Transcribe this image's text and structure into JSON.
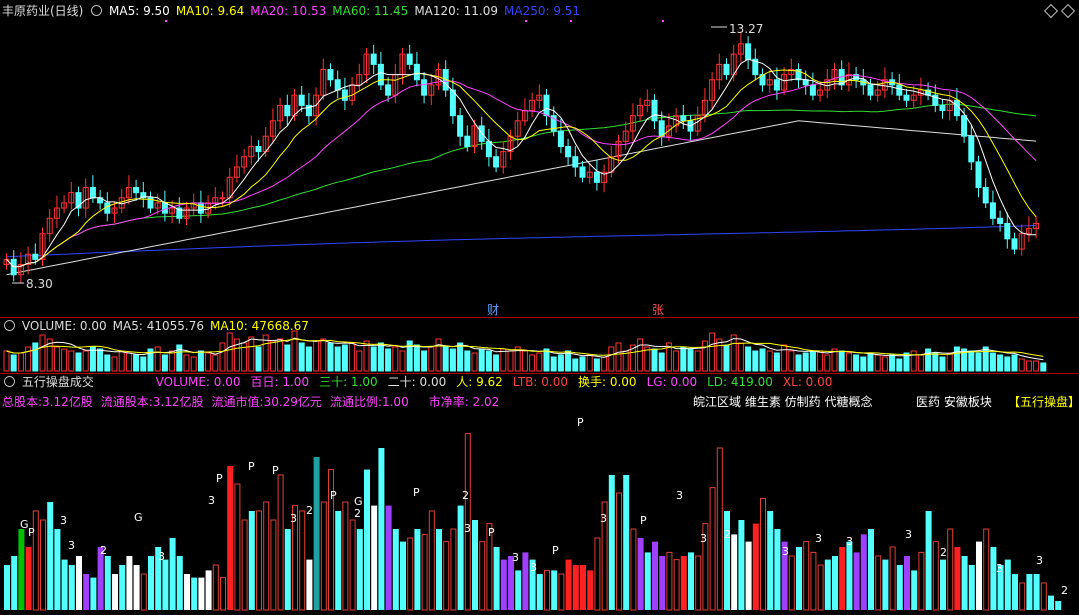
{
  "header": {
    "title": "丰原药业(日线)",
    "ma_items": [
      {
        "label": "MA5: 9.50",
        "color": "#ffffff"
      },
      {
        "label": "MA10: 9.64",
        "color": "#ffff00"
      },
      {
        "label": "MA20: 10.53",
        "color": "#ff44ff"
      },
      {
        "label": "MA60: 11.45",
        "color": "#33dd33"
      },
      {
        "label": "MA120: 11.09",
        "color": "#dddddd"
      },
      {
        "label": "MA250: 9.51",
        "color": "#3344ff"
      }
    ]
  },
  "price_panel": {
    "high_label": "13.27",
    "low_label": "8.30",
    "event_markers": [
      "财",
      "张"
    ]
  },
  "volume_header": {
    "items": [
      {
        "label": "VOLUME: 0.00",
        "color": "#dddddd"
      },
      {
        "label": "MA5: 41055.76",
        "color": "#dddddd"
      },
      {
        "label": "MA10: 47668.67",
        "color": "#ffff00"
      }
    ]
  },
  "indicator_header": {
    "name": "五行操盘成交",
    "items": [
      {
        "label": "VOLUME: 0.00",
        "color": "#ff44ff"
      },
      {
        "label": "百日: 1.00",
        "color": "#ff44ff"
      },
      {
        "label": "三十: 1.00",
        "color": "#33dd33"
      },
      {
        "label": "二十: 0.00",
        "color": "#dddddd"
      },
      {
        "label": "人: 9.62",
        "color": "#ffff00"
      },
      {
        "label": "LTB: 0.00",
        "color": "#ff4444"
      },
      {
        "label": "换手: 0.00",
        "color": "#ffff00"
      },
      {
        "label": "LG: 0.00",
        "color": "#ff44ff"
      },
      {
        "label": "LD: 419.00",
        "color": "#33dd33"
      },
      {
        "label": "XL: 0.00",
        "color": "#ff4444"
      }
    ]
  },
  "info_row": {
    "items": [
      "总股本:3.12亿股",
      "流通股本:3.12亿股",
      "流通市值:30.29亿元",
      "流通比例:1.00",
      "市净率: 2.02"
    ],
    "concepts": "皖江区域 维生素 仿制药 代糖概念",
    "sector": "医药 安徽板块",
    "tag": "【五行操盘】"
  },
  "chart_data": {
    "type": "candlestick",
    "colors": {
      "up": "#ff3232",
      "down": "#54ffff",
      "ma5": "#ffffff",
      "ma10": "#ffff00",
      "ma20": "#ff44ff",
      "ma60": "#33dd33",
      "ma120": "#dddddd",
      "ma250": "#3344ff",
      "bar_red": "#ff2020",
      "bar_cyan": "#54ffff",
      "bar_white": "#ffffff",
      "bar_purple": "#a040ff",
      "bar_green": "#00c000",
      "bar_teal": "#20a0a0"
    },
    "y_min": 8.3,
    "y_max": 13.27,
    "closes": [
      8.8,
      8.5,
      8.7,
      8.9,
      8.8,
      9.3,
      9.6,
      9.8,
      9.9,
      10.1,
      9.8,
      10.2,
      10.0,
      9.9,
      9.7,
      9.8,
      10.0,
      10.2,
      10.1,
      10.0,
      9.8,
      9.9,
      9.7,
      9.8,
      9.6,
      9.8,
      9.9,
      9.7,
      9.9,
      10.0,
      10.0,
      10.4,
      10.6,
      10.8,
      11.0,
      10.9,
      11.2,
      11.5,
      11.8,
      11.6,
      12.0,
      11.8,
      11.6,
      12.0,
      12.5,
      12.3,
      12.1,
      11.9,
      12.2,
      12.4,
      12.8,
      12.6,
      12.2,
      12.0,
      12.4,
      12.8,
      12.6,
      12.3,
      12.0,
      12.2,
      12.5,
      12.1,
      11.6,
      11.2,
      11.0,
      11.4,
      11.1,
      10.8,
      10.6,
      10.9,
      11.2,
      11.5,
      11.7,
      11.9,
      12.0,
      11.6,
      11.3,
      11.0,
      10.8,
      10.6,
      10.4,
      10.5,
      10.3,
      10.5,
      10.8,
      11.1,
      11.3,
      11.6,
      11.8,
      11.9,
      11.5,
      11.2,
      11.4,
      11.6,
      11.5,
      11.3,
      11.6,
      11.9,
      12.3,
      12.6,
      12.4,
      12.8,
      13.0,
      12.7,
      12.4,
      12.2,
      12.3,
      12.1,
      12.4,
      12.5,
      12.3,
      12.2,
      12.0,
      12.1,
      12.3,
      12.5,
      12.2,
      12.4,
      12.3,
      12.2,
      12.0,
      12.1,
      12.3,
      12.2,
      12.0,
      11.9,
      12.0,
      12.1,
      12.0,
      11.8,
      11.7,
      11.9,
      11.6,
      11.2,
      10.7,
      10.2,
      9.9,
      9.6,
      9.5,
      9.2,
      9.0,
      9.3,
      9.4,
      9.5
    ],
    "vol_ratio": [
      0.5,
      0.4,
      0.45,
      0.6,
      0.7,
      0.9,
      0.8,
      0.6,
      0.55,
      0.5,
      0.45,
      0.5,
      0.6,
      0.55,
      0.4,
      0.35,
      0.5,
      0.45,
      0.4,
      0.35,
      0.55,
      0.6,
      0.4,
      0.5,
      0.65,
      0.4,
      0.35,
      0.5,
      0.45,
      0.4,
      0.7,
      0.95,
      0.8,
      0.7,
      0.85,
      0.6,
      0.9,
      0.75,
      0.8,
      0.65,
      1.0,
      0.7,
      0.6,
      0.75,
      0.8,
      0.7,
      0.6,
      0.65,
      0.7,
      0.5,
      0.75,
      0.6,
      0.7,
      0.55,
      0.6,
      0.5,
      0.75,
      0.65,
      0.5,
      0.6,
      0.8,
      0.6,
      0.55,
      0.7,
      0.5,
      0.45,
      0.55,
      0.5,
      0.4,
      0.55,
      0.5,
      0.6,
      0.5,
      0.4,
      0.45,
      0.55,
      0.35,
      0.4,
      0.5,
      0.3,
      0.35,
      0.4,
      0.3,
      0.35,
      0.6,
      0.7,
      0.5,
      0.65,
      0.8,
      0.6,
      0.55,
      0.45,
      0.7,
      0.5,
      0.6,
      0.55,
      0.5,
      0.75,
      0.95,
      0.8,
      0.65,
      0.9,
      0.7,
      0.6,
      0.5,
      0.55,
      0.5,
      0.45,
      0.65,
      0.5,
      0.4,
      0.45,
      0.5,
      0.5,
      0.4,
      0.55,
      0.5,
      0.45,
      0.4,
      0.35,
      0.45,
      0.4,
      0.35,
      0.4,
      0.3,
      0.45,
      0.5,
      0.4,
      0.55,
      0.45,
      0.35,
      0.45,
      0.6,
      0.55,
      0.5,
      0.45,
      0.6,
      0.45,
      0.4,
      0.35,
      0.4,
      0.3,
      0.25,
      0.25,
      0.2
    ],
    "bar_heights": [
      0.25,
      0.3,
      0.45,
      0.35,
      0.55,
      0.5,
      0.6,
      0.45,
      0.28,
      0.25,
      0.3,
      0.2,
      0.18,
      0.35,
      0.3,
      0.2,
      0.25,
      0.3,
      0.25,
      0.2,
      0.3,
      0.35,
      0.28,
      0.4,
      0.3,
      0.2,
      0.18,
      0.18,
      0.22,
      0.25,
      0.18,
      0.8,
      0.7,
      0.5,
      0.55,
      0.55,
      0.6,
      0.5,
      0.75,
      0.45,
      0.58,
      0.55,
      0.28,
      0.85,
      0.6,
      0.78,
      0.55,
      0.6,
      0.5,
      0.45,
      0.78,
      0.58,
      0.9,
      0.58,
      0.45,
      0.38,
      0.4,
      0.45,
      0.42,
      0.55,
      0.45,
      0.38,
      0.45,
      0.58,
      0.98,
      0.5,
      0.38,
      0.48,
      0.35,
      0.28,
      0.3,
      0.22,
      0.32,
      0.28,
      0.2,
      0.22,
      0.22,
      0.2,
      0.28,
      0.25,
      0.25,
      0.22,
      0.4,
      0.6,
      0.75,
      0.65,
      0.75,
      0.45,
      0.4,
      0.32,
      0.38,
      0.3,
      0.32,
      0.28,
      0.3,
      0.32,
      0.3,
      0.48,
      0.68,
      0.9,
      0.55,
      0.42,
      0.5,
      0.38,
      0.48,
      0.62,
      0.55,
      0.45,
      0.38,
      0.3,
      0.35,
      0.38,
      0.32,
      0.25,
      0.28,
      0.3,
      0.35,
      0.38,
      0.32,
      0.42,
      0.45,
      0.3,
      0.28,
      0.35,
      0.25,
      0.3,
      0.22,
      0.32,
      0.55,
      0.38,
      0.28,
      0.45,
      0.35,
      0.3,
      0.25,
      0.38,
      0.45,
      0.35,
      0.25,
      0.28,
      0.2,
      0.15,
      0.2,
      0.2,
      0.15,
      0.08,
      0.05
    ],
    "bar_types": [
      "c",
      "c",
      "g",
      "r",
      "h",
      "h",
      "c",
      "c",
      "c",
      "c",
      "w",
      "p",
      "c",
      "p",
      "c",
      "w",
      "c",
      "w",
      "w",
      "h",
      "c",
      "c",
      "c",
      "c",
      "c",
      "w",
      "c",
      "w",
      "w",
      "h",
      "h",
      "r",
      "h",
      "h",
      "c",
      "h",
      "h",
      "h",
      "h",
      "c",
      "h",
      "h",
      "w",
      "t",
      "h",
      "h",
      "c",
      "h",
      "h",
      "c",
      "c",
      "w",
      "c",
      "p",
      "c",
      "c",
      "h",
      "c",
      "h",
      "h",
      "c",
      "h",
      "h",
      "c",
      "h",
      "c",
      "h",
      "h",
      "c",
      "p",
      "p",
      "c",
      "p",
      "c",
      "c",
      "h",
      "c",
      "h",
      "r",
      "r",
      "r",
      "r",
      "h",
      "h",
      "c",
      "h",
      "c",
      "h",
      "p",
      "c",
      "p",
      "p",
      "h",
      "h",
      "r",
      "c",
      "h",
      "h",
      "h",
      "h",
      "c",
      "w",
      "c",
      "w",
      "r",
      "h",
      "c",
      "c",
      "p",
      "h",
      "c",
      "h",
      "h",
      "h",
      "c",
      "c",
      "r",
      "c",
      "p",
      "p",
      "c",
      "h",
      "c",
      "h",
      "c",
      "p",
      "c",
      "h",
      "c",
      "h",
      "c",
      "h",
      "r",
      "c",
      "c",
      "w",
      "h",
      "c",
      "c",
      "c",
      "c",
      "h",
      "c",
      "c",
      "h",
      "c"
    ]
  }
}
